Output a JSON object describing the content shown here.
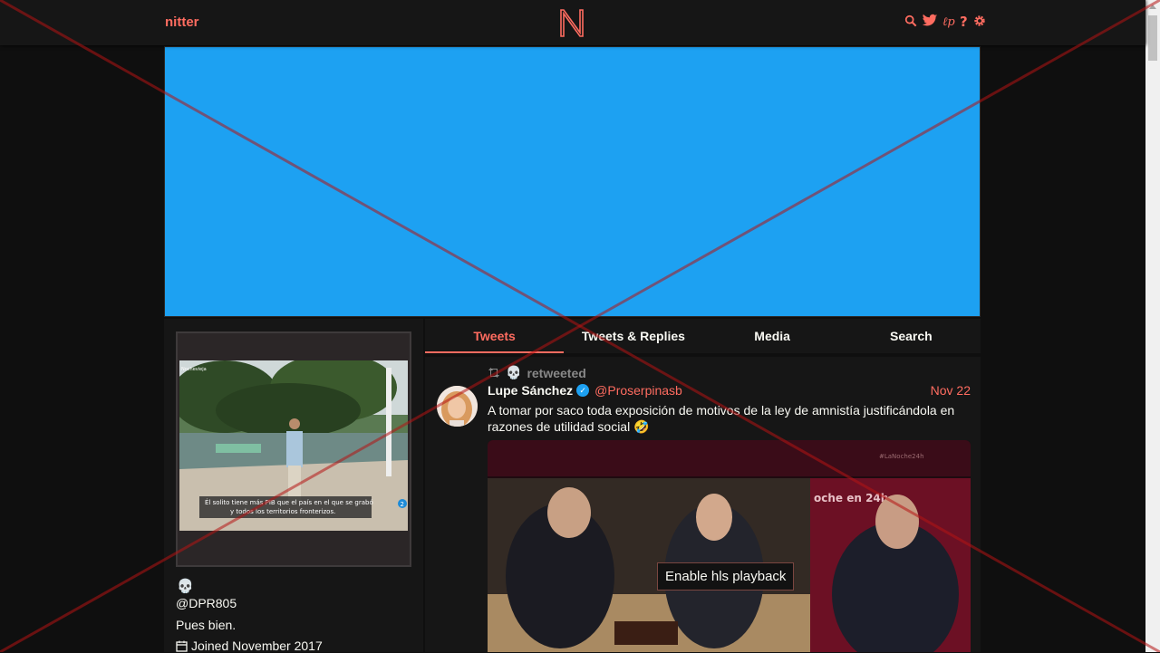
{
  "navbar": {
    "brand": "nitter",
    "icons": [
      "search-icon",
      "twitter-icon",
      "instance-icon",
      "help-icon",
      "settings-icon"
    ],
    "accent": "#ff6c60"
  },
  "banner": {
    "color": "#1da1f2"
  },
  "profile": {
    "emoji": "💀",
    "handle": "@DPR805",
    "bio": "Pues bien.",
    "joined": "Joined November 2017",
    "avatar_caption": "Él solito tiene más PIB que el país en el que se grabó y todos los territorios fronterizos.",
    "avatar_tag": "Nochevieja",
    "avatar_badge": "2"
  },
  "tabs": [
    {
      "label": "Tweets",
      "active": true
    },
    {
      "label": "Tweets & Replies",
      "active": false
    },
    {
      "label": "Media",
      "active": false
    },
    {
      "label": "Search",
      "active": false
    }
  ],
  "tweet": {
    "retweeted_by": "💀",
    "retweet_label": "retweeted",
    "fullname": "Lupe Sánchez",
    "username": "@Proserpinasb",
    "date": "Nov 22",
    "text": "A tomar por saco toda exposición de motivos de la ley de amnistía justificándola en razones de utilidad social 🤣",
    "media": {
      "hashtag": "#LaNoche24h",
      "overlay_text": "oche en 24h",
      "button_label": "Enable hls playback"
    }
  }
}
